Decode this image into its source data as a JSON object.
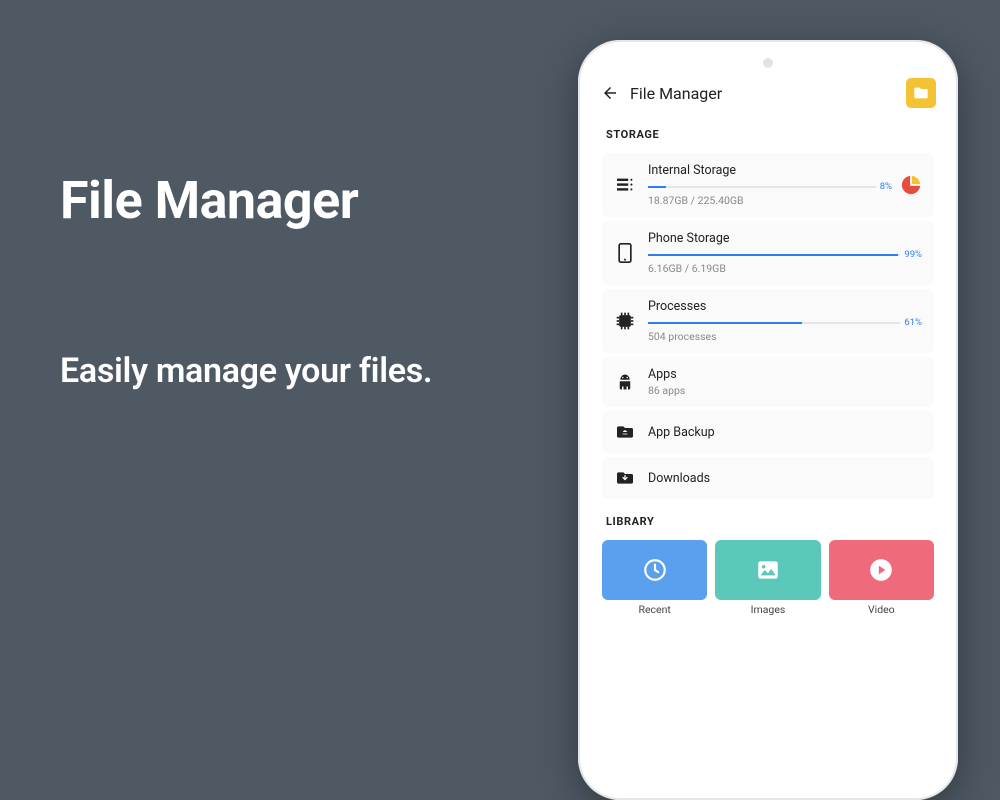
{
  "hero": {
    "title": "File Manager",
    "subtitle": "Easily manage your files."
  },
  "appbar": {
    "title": "File Manager"
  },
  "sections": {
    "storage": "STORAGE",
    "library": "LIBRARY"
  },
  "storage": {
    "internal": {
      "title": "Internal Storage",
      "percent_label": "8%",
      "percent": 8,
      "detail": "18.87GB / 225.40GB"
    },
    "phone": {
      "title": "Phone Storage",
      "percent_label": "99%",
      "percent": 99,
      "detail": "6.16GB / 6.19GB"
    },
    "processes": {
      "title": "Processes",
      "percent_label": "61%",
      "percent": 61,
      "detail": "504 processes"
    },
    "apps": {
      "title": "Apps",
      "detail": "86 apps"
    },
    "backup": {
      "title": "App Backup"
    },
    "downloads": {
      "title": "Downloads"
    }
  },
  "library": {
    "recent": "Recent",
    "images": "Images",
    "video": "Video"
  }
}
